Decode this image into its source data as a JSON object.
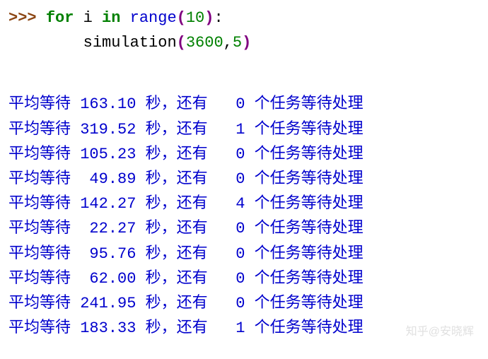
{
  "code": {
    "prompt": ">>> ",
    "for_kw": "for",
    "var": "i",
    "in_kw": "in",
    "range_fn": "range",
    "range_arg": "10",
    "indent": "        ",
    "sim_fn": "simulation",
    "sim_arg1": "3600",
    "sim_arg2": "5"
  },
  "output": {
    "prefix": "平均等待 ",
    "mid": " 秒，还有 ",
    "suffix": " 个任务等待处理",
    "rows": [
      {
        "wait": "163.10",
        "tasks": "  0"
      },
      {
        "wait": "319.52",
        "tasks": "  1"
      },
      {
        "wait": "105.23",
        "tasks": "  0"
      },
      {
        "wait": " 49.89",
        "tasks": "  0"
      },
      {
        "wait": "142.27",
        "tasks": "  4"
      },
      {
        "wait": " 22.27",
        "tasks": "  0"
      },
      {
        "wait": " 95.76",
        "tasks": "  0"
      },
      {
        "wait": " 62.00",
        "tasks": "  0"
      },
      {
        "wait": "241.95",
        "tasks": "  0"
      },
      {
        "wait": "183.33",
        "tasks": "  1"
      }
    ]
  },
  "watermark": "知乎@安晓辉"
}
